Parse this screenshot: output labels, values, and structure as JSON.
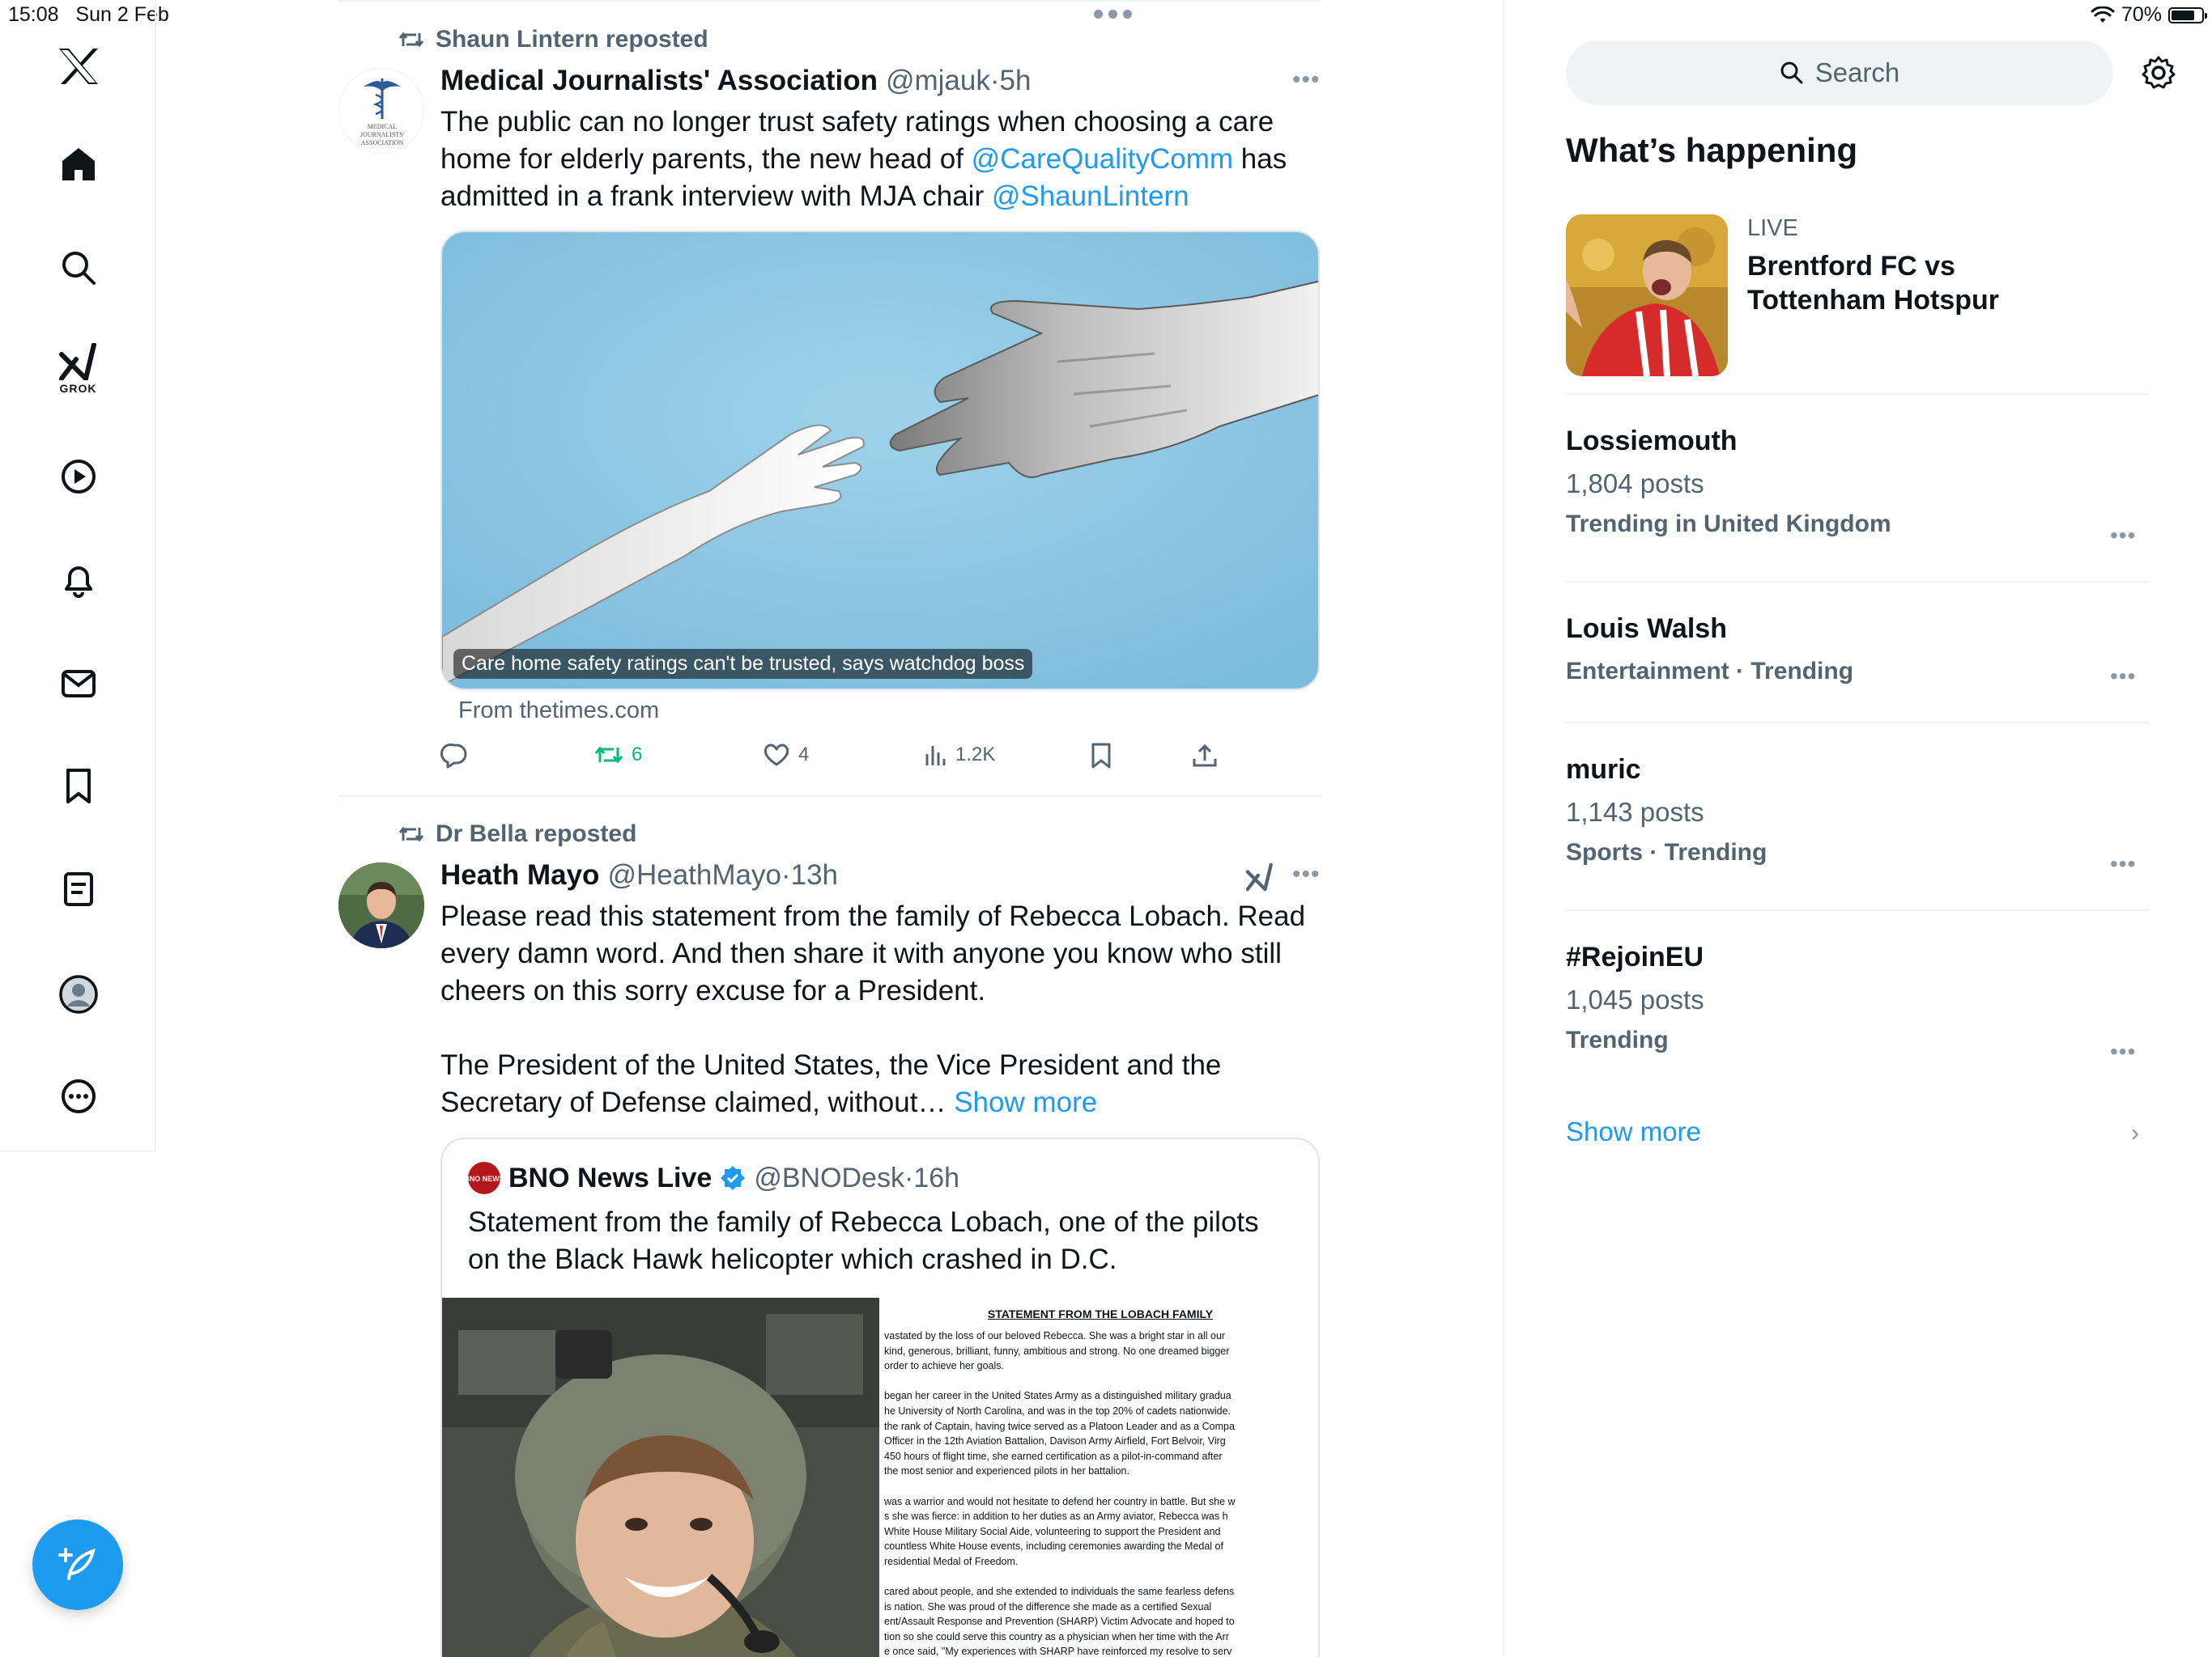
{
  "status_bar": {
    "time": "15:08",
    "date": "Sun 2 Feb",
    "battery": "70%",
    "battery_level": 0.7
  },
  "nav": {
    "grok_label": "GROK",
    "icons": [
      "x-logo-icon",
      "home-icon",
      "search-icon",
      "grok-icon",
      "video-icon",
      "notifications-icon",
      "messages-icon",
      "bookmarks-icon",
      "lists-icon",
      "profile-icon",
      "more-icon",
      "compose-icon"
    ]
  },
  "tweets": [
    {
      "reposted_by": "Shaun Lintern reposted",
      "name": "Medical Journalists' Association",
      "handle": "@mjauk",
      "time": "·5h",
      "avatar_text": [
        "MEDICAL",
        "JOURNALISTS'",
        "ASSOCIATION"
      ],
      "text_parts": [
        "The public can no longer trust safety ratings when choosing a care home for elderly parents, the new head of ",
        "@CareQualityComm",
        " has admitted in a frank interview with MJA chair ",
        "@ShaunLintern"
      ],
      "card_caption": "Care home safety ratings can't be trusted, says watchdog boss",
      "card_source": "From thetimes.com",
      "actions": {
        "reposts": "6",
        "likes": "4",
        "views": "1.2K"
      }
    },
    {
      "reposted_by": "Dr Bella reposted",
      "name": "Heath Mayo",
      "handle": "@HeathMayo",
      "time": "·13h",
      "text_p1": "Please read this statement from the family of Rebecca Lobach. Read every damn word. And then share it with anyone you know who still cheers on this sorry excuse for a President.",
      "text_p2": "The President of the United States, the Vice President and the Secretary of Defense claimed, without…",
      "show_more": "Show more",
      "quote": {
        "avatar_text": "BNO NEWS",
        "name": "BNO News Live",
        "handle": "@BNODesk",
        "time": "·16h",
        "text": "Statement from the family of Rebecca Lobach, one of the pilots on the Black Hawk helicopter which crashed in D.C.",
        "doc_title": "STATEMENT FROM THE LOBACH FAMILY",
        "doc_lines": [
          "vastated by the loss of our beloved Rebecca. She was a bright star in all our",
          "kind, generous, brilliant, funny, ambitious and strong. No one dreamed bigger",
          "order to achieve her goals.",
          "",
          "began her career in the United States Army as a distinguished military gradua",
          "he University of North Carolina, and was in the top 20% of cadets nationwide.",
          "the rank of Captain, having twice served as a Platoon Leader and as a Compa",
          "Officer in the 12th Aviation Battalion, Davison Army Airfield, Fort Belvoir, Virg",
          "450 hours of flight time, she earned certification as a pilot-in-command after",
          "the most senior and experienced pilots in her battalion.",
          "",
          "was a warrior and would not hesitate to defend her country in battle. But she w",
          "s she was fierce: in addition to her duties as an Army aviator, Rebecca was h",
          "White House Military Social Aide, volunteering to support the President and",
          "countless White House events, including ceremonies awarding the Medal of",
          "residential Medal of Freedom.",
          "",
          "cared about people, and she extended to individuals the same fearless defens",
          "is nation. She was proud of the difference she made as a certified Sexual",
          "ent/Assault Response and Prevention (SHARP) Victim Advocate and hoped to",
          "tion so she could serve this country as a physician when her time with the Arr",
          "e once said, \"My experiences with SHARP have reinforced my resolve to serv"
        ]
      }
    }
  ],
  "sidebar": {
    "search_placeholder": "Search",
    "whats_happening": "What’s happening",
    "live": {
      "label": "LIVE",
      "title": "Brentford FC vs Tottenham Hotspur"
    },
    "trends": [
      {
        "name": "Lossiemouth",
        "count": "1,804 posts",
        "context": "Trending in United Kingdom"
      },
      {
        "name": "Louis Walsh",
        "count": "",
        "context": "Entertainment · Trending"
      },
      {
        "name": "muric",
        "count": "1,143 posts",
        "context": "Sports · Trending"
      },
      {
        "name": "#RejoinEU",
        "count": "1,045 posts",
        "context": "Trending"
      }
    ],
    "show_more": "Show more"
  },
  "colors": {
    "accent": "#1d9bf0",
    "repost_green": "#00ba7c",
    "muted": "#536471",
    "text": "#0f1419"
  }
}
